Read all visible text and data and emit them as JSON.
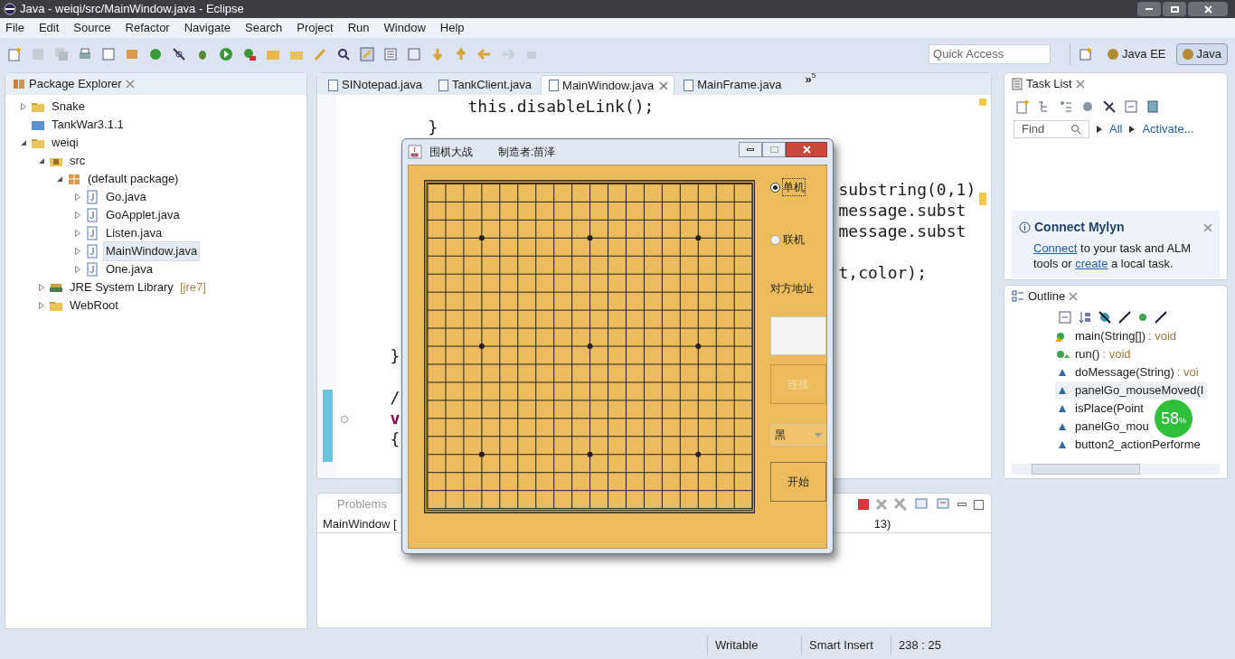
{
  "window": {
    "title": "Java - weiqi/src/MainWindow.java - Eclipse"
  },
  "menu": [
    "File",
    "Edit",
    "Source",
    "Refactor",
    "Navigate",
    "Search",
    "Project",
    "Run",
    "Window",
    "Help"
  ],
  "quick_access": {
    "placeholder": "Quick Access"
  },
  "perspectives": [
    {
      "label": "Java EE",
      "selected": false
    },
    {
      "label": "Java",
      "selected": true
    }
  ],
  "package_explorer": {
    "title": "Package Explorer",
    "tree": [
      {
        "label": "Snake",
        "expanded": false,
        "selected": false,
        "kind": "project"
      },
      {
        "label": "TankWar3.1.1",
        "selected": false,
        "kind": "folder"
      },
      {
        "label": "weiqi",
        "expanded": true,
        "selected": false,
        "kind": "project",
        "children": [
          {
            "label": "src",
            "expanded": true,
            "selected": false,
            "kind": "source",
            "children": [
              {
                "label": "(default package)",
                "expanded": true,
                "selected": false,
                "kind": "package",
                "children": [
                  {
                    "label": "Go.java",
                    "expanded": false,
                    "selected": false,
                    "kind": "java"
                  },
                  {
                    "label": "GoApplet.java",
                    "expanded": false,
                    "selected": false,
                    "kind": "java"
                  },
                  {
                    "label": "Listen.java",
                    "expanded": false,
                    "selected": false,
                    "kind": "java"
                  },
                  {
                    "label": "MainWindow.java",
                    "expanded": false,
                    "selected": true,
                    "kind": "java"
                  },
                  {
                    "label": "One.java",
                    "expanded": false,
                    "selected": false,
                    "kind": "java"
                  }
                ]
              }
            ]
          },
          {
            "label": "JRE System Library",
            "decoration": "[jre7]",
            "expanded": false,
            "selected": false,
            "kind": "library"
          },
          {
            "label": "WebRoot",
            "expanded": false,
            "selected": false,
            "kind": "project"
          }
        ]
      }
    ]
  },
  "editor": {
    "tabs": [
      {
        "label": "SINotepad.java",
        "selected": false
      },
      {
        "label": "TankClient.java",
        "selected": false
      },
      {
        "label": "MainWindow.java",
        "selected": true
      },
      {
        "label": "MainFrame.java",
        "selected": false
      }
    ],
    "overflow": {
      "glyph": "»",
      "count": "5"
    },
    "lines": [
      {
        "text": "this.disableLink();"
      },
      {
        "text": "}"
      },
      {
        "text": "substring(0,1)"
      },
      {
        "text": "message.subst"
      },
      {
        "text": "message.subst"
      },
      {
        "text": "t,color);"
      },
      {
        "text": "}"
      },
      {
        "text": "/"
      },
      {
        "text": "v",
        "kind": "keyword"
      },
      {
        "text": "{"
      }
    ]
  },
  "task_list": {
    "title": "Task List",
    "find": {
      "placeholder": "Find"
    },
    "links": [
      "All",
      "Activate..."
    ]
  },
  "mylyn": {
    "title": "Connect Mylyn",
    "parts": [
      {
        "text": "Connect",
        "kind": "link"
      },
      {
        "text": " to your task and ALM tools or ",
        "kind": "plain"
      },
      {
        "text": "create",
        "kind": "link"
      },
      {
        "text": " a local task.",
        "kind": "plain"
      }
    ]
  },
  "outline": {
    "title": "Outline",
    "items": [
      {
        "name": "main(String[])",
        "type": ": void",
        "kind": "static",
        "selected": false
      },
      {
        "name": "run()",
        "type": ": void",
        "kind": "public",
        "selected": false
      },
      {
        "name": "doMessage(String)",
        "type": ": voi",
        "kind": "default",
        "selected": false
      },
      {
        "name": "panelGo_mouseMoved(I",
        "kind": "default",
        "selected": true
      },
      {
        "name": "isPlace(Point",
        "kind": "default",
        "selected": false
      },
      {
        "name": "panelGo_mou",
        "kind": "default",
        "selected": false
      },
      {
        "name": "button2_actionPerforme",
        "kind": "default",
        "selected": false
      }
    ]
  },
  "speed_widget": {
    "percent": "58",
    "unit": "%"
  },
  "bottom_panel": {
    "tab": "Problems",
    "console_left": "MainWindow [",
    "console_right": "13)"
  },
  "status_bar": [
    "Writable",
    "Smart Insert",
    "238 : 25"
  ],
  "dialog": {
    "title": "围棋大战",
    "author": "制造者:苗泽",
    "modes": [
      {
        "label": "单机",
        "selected": true
      },
      {
        "label": "联机",
        "selected": false
      }
    ],
    "address_label": "对方地址",
    "connect": {
      "label": "连接",
      "disabled": true
    },
    "color_select": {
      "value": "黑"
    },
    "start": {
      "label": "开始",
      "disabled": false
    }
  }
}
